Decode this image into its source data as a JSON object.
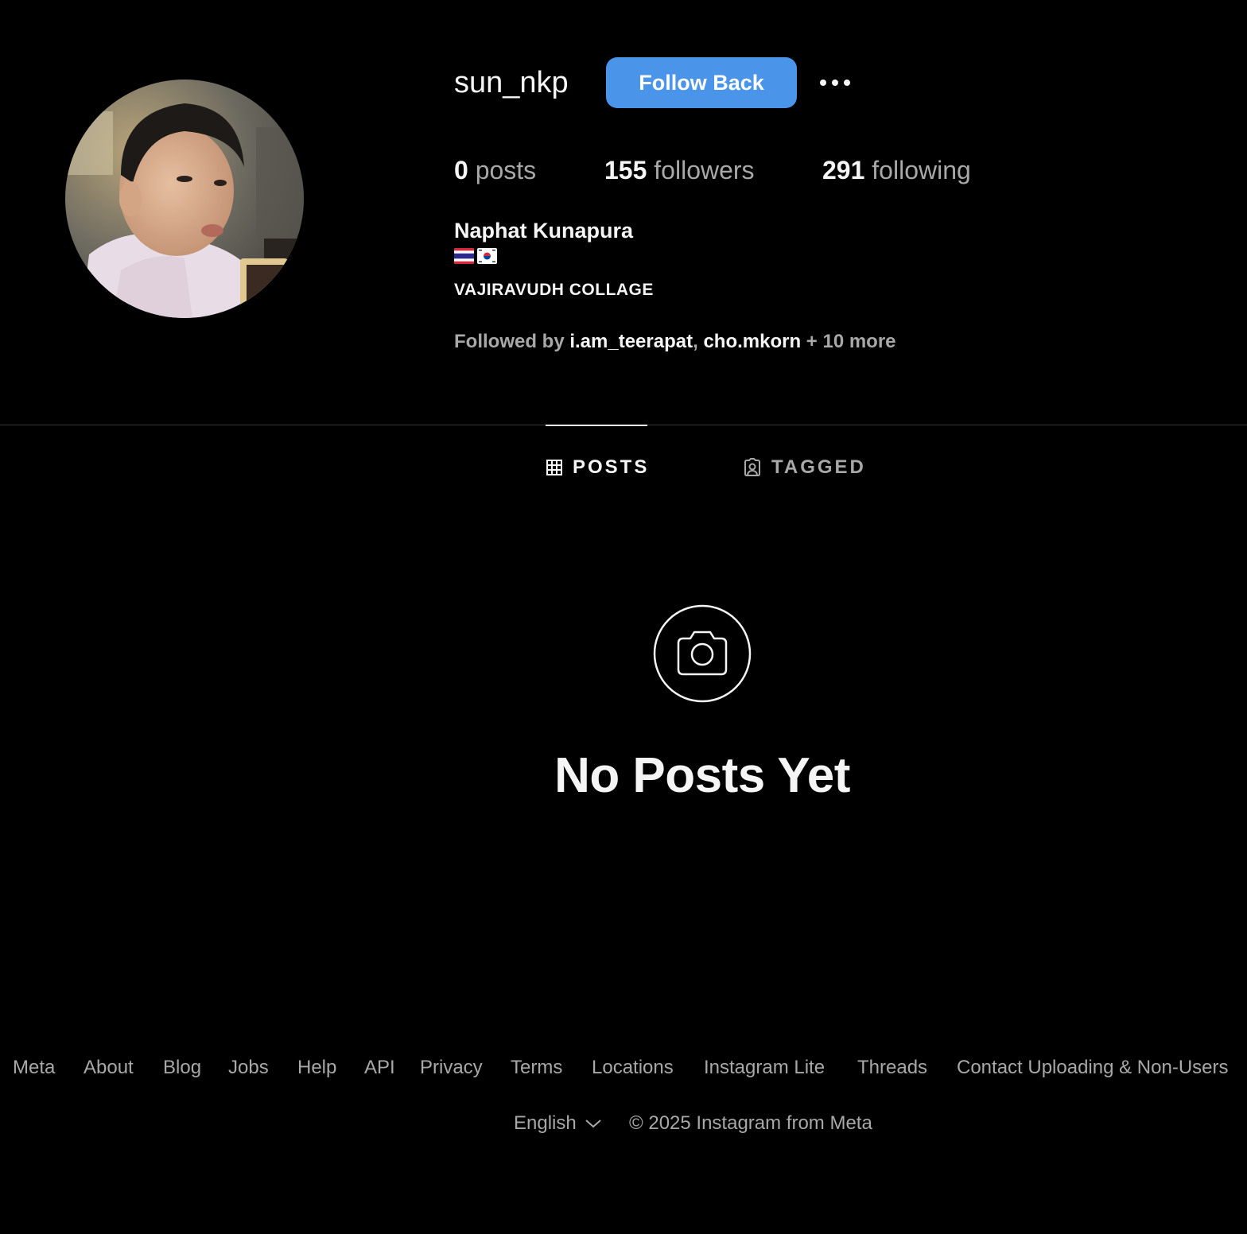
{
  "profile": {
    "username": "sun_nkp",
    "follow_button": "Follow Back",
    "more_icon": "more-horizontal-icon",
    "stats": {
      "posts_count": "0",
      "posts_label": " posts",
      "followers_count": "155",
      "followers_label": " followers",
      "following_count": "291",
      "following_label": " following"
    },
    "full_name": "Naphat Kunapura",
    "bio_flags": "🇹🇭🇰🇷",
    "bio_line": "VAJIRAVUDH COLLAGE",
    "followed_by": {
      "prefix": "Followed by ",
      "user1": "i.am_teerapat",
      "separator": ", ",
      "user2": "cho.mkorn",
      "suffix": " + 10 more"
    }
  },
  "tabs": [
    {
      "label": "POSTS",
      "icon": "grid-icon",
      "active": true
    },
    {
      "label": "TAGGED",
      "icon": "tagged-user-icon",
      "active": false
    }
  ],
  "empty_state": {
    "icon": "camera-icon",
    "title": "No Posts Yet"
  },
  "footer": {
    "links": [
      "Meta",
      "About",
      "Blog",
      "Jobs",
      "Help",
      "API",
      "Privacy",
      "Terms",
      "Locations",
      "Instagram Lite",
      "Threads",
      "Contact Uploading & Non-Users"
    ],
    "language": "English",
    "copyright": "© 2025 Instagram from Meta"
  },
  "colors": {
    "background": "#000000",
    "primary_button": "#4a95ea",
    "text_primary": "#f5f5f5",
    "text_secondary": "#a8a8a8",
    "divider": "#363636"
  }
}
